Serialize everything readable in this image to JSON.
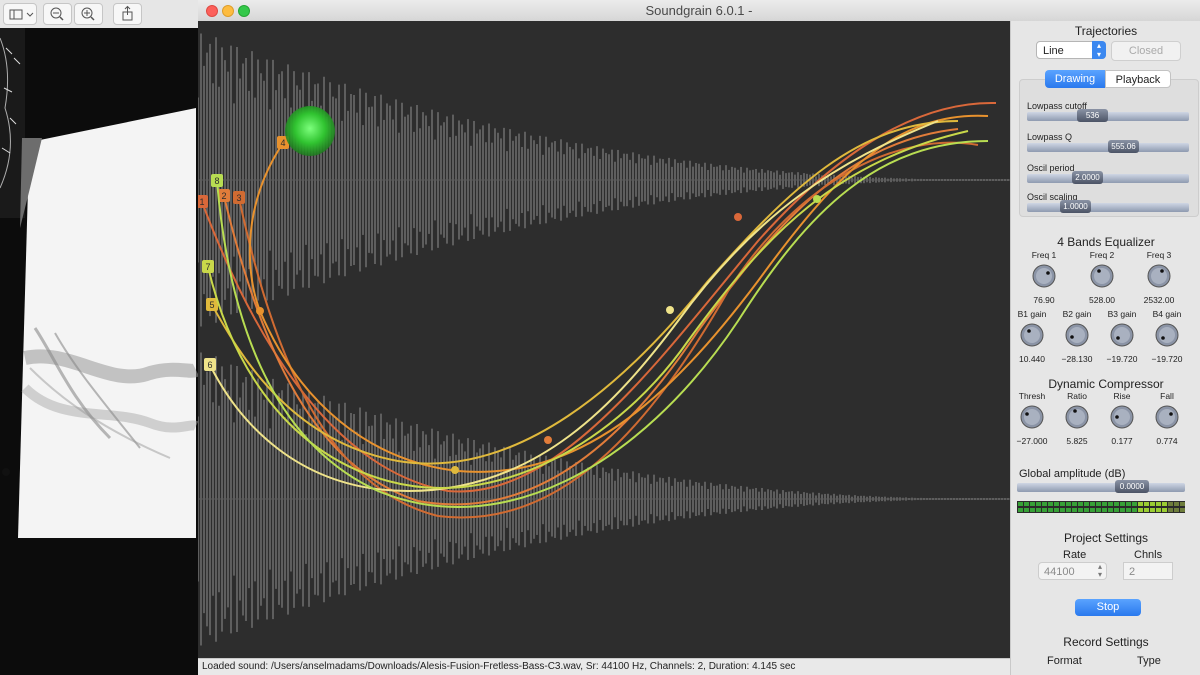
{
  "window": {
    "title": "Soundgrain 6.0.1 -"
  },
  "status_bar": {
    "text": "Loaded sound: /Users/anselmadams/Downloads/Alesis-Fusion-Fretless-Bass-C3.wav,  Sr: 44100 Hz,  Channels: 2,  Duration: 4.145 sec"
  },
  "trajectories": {
    "title": "Trajectories",
    "type_value": "Line",
    "closed_label": "Closed",
    "labels": [
      "1",
      "2",
      "3",
      "4",
      "5",
      "6",
      "7",
      "8"
    ]
  },
  "tabs": {
    "drawing": "Drawing",
    "playback": "Playback",
    "active": "Drawing"
  },
  "sliders": [
    {
      "label": "Lowpass cutoff",
      "value": "536",
      "fraction": 0.38
    },
    {
      "label": "Lowpass Q",
      "value": "555.06",
      "fraction": 0.62
    },
    {
      "label": "Oscil period",
      "value": "2.0000",
      "fraction": 0.34
    },
    {
      "label": "Oscil scaling",
      "value": "1.0000",
      "fraction": 0.25
    }
  ],
  "equalizer": {
    "title": "4 Bands Equalizer",
    "freqs": [
      {
        "label": "Freq 1",
        "value": "76.90"
      },
      {
        "label": "Freq 2",
        "value": "528.00"
      },
      {
        "label": "Freq 3",
        "value": "2532.00"
      }
    ],
    "gains": [
      {
        "label": "B1 gain",
        "value": "10.440"
      },
      {
        "label": "B2 gain",
        "value": "−28.130"
      },
      {
        "label": "B3 gain",
        "value": "−19.720"
      },
      {
        "label": "B4 gain",
        "value": "−19.720"
      }
    ]
  },
  "compressor": {
    "title": "Dynamic Compressor",
    "knobs": [
      {
        "label": "Thresh",
        "value": "−27.000"
      },
      {
        "label": "Ratio",
        "value": "5.825"
      },
      {
        "label": "Rise",
        "value": "0.177"
      },
      {
        "label": "Fall",
        "value": "0.774"
      }
    ]
  },
  "global_amplitude": {
    "label": "Global amplitude (dB)",
    "value": "0.0000",
    "fraction": 0.73
  },
  "project_settings": {
    "title": "Project Settings",
    "rate_label": "Rate",
    "rate_value": "44100",
    "chnls_label": "Chnls",
    "chnls_value": "2"
  },
  "stop_label": "Stop",
  "record_settings": {
    "title": "Record Settings",
    "format_label": "Format",
    "type_label": "Type"
  },
  "colors": {
    "accent": "#3b88f0",
    "canvas_bg": "#2d2d2d",
    "granulator": "#3fdc3f"
  }
}
